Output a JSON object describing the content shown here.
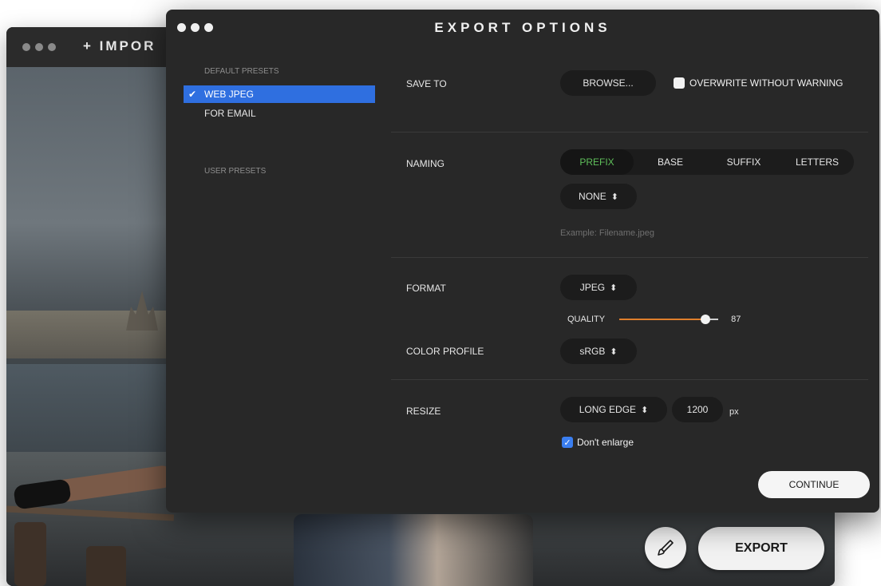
{
  "back_window": {
    "title": "+ IMPOR",
    "export_label": "EXPORT",
    "brush_icon": "brush-icon"
  },
  "dialog": {
    "title": "EXPORT OPTIONS"
  },
  "sidebar": {
    "default_presets_label": "DEFAULT PRESETS",
    "presets": [
      {
        "label": "WEB JPEG",
        "selected": true
      },
      {
        "label": "FOR EMAIL",
        "selected": false
      }
    ],
    "user_presets_label": "USER PRESETS"
  },
  "save_to": {
    "label": "SAVE TO",
    "browse_label": "BROWSE...",
    "overwrite_label": "OVERWRITE WITHOUT WARNING",
    "overwrite_checked": false
  },
  "naming": {
    "label": "NAMING",
    "tabs": [
      "PREFIX",
      "BASE",
      "SUFFIX",
      "LETTERS"
    ],
    "active_tab": "PREFIX",
    "prefix_value": "NONE",
    "example": "Example: Filename.jpeg"
  },
  "format": {
    "label": "FORMAT",
    "value": "JPEG",
    "quality_label": "QUALITY",
    "quality_value": "87",
    "quality_fraction": 0.87
  },
  "color_profile": {
    "label": "COLOR PROFILE",
    "value": "sRGB"
  },
  "resize": {
    "label": "RESIZE",
    "mode": "LONG EDGE",
    "size": "1200",
    "unit": "px",
    "dont_enlarge_label": "Don't enlarge",
    "dont_enlarge_checked": true
  },
  "continue_label": "CONTINUE",
  "colors": {
    "accent_blue": "#2f6fe0",
    "slider_orange": "#e07f2c",
    "active_tab_green": "#5fbf5a"
  }
}
